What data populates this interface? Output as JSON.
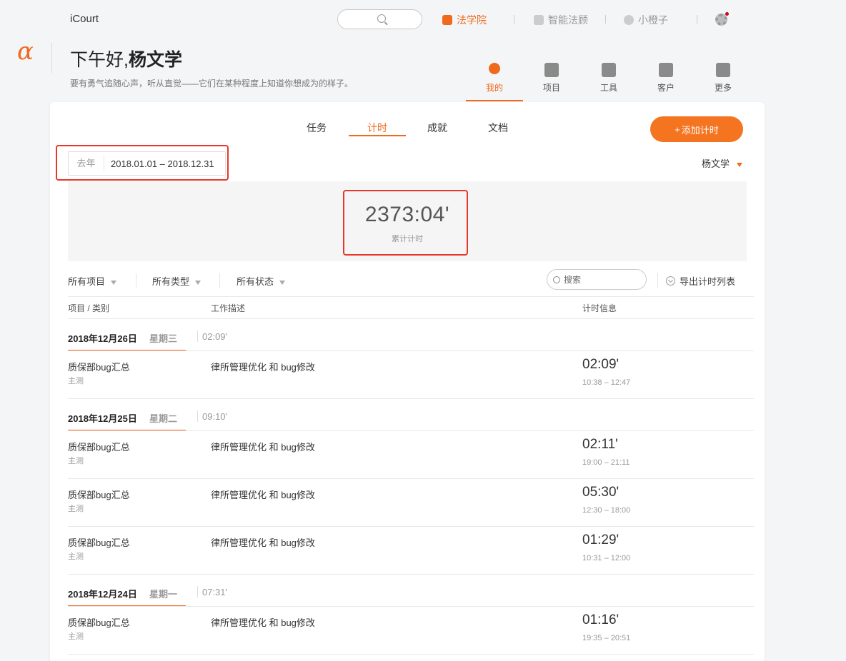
{
  "app": {
    "brand": "iCourt"
  },
  "topnav": {
    "items": [
      {
        "label": "法学院",
        "icon": "play-icon",
        "active": true
      },
      {
        "label": "智能法顾",
        "icon": "document-icon",
        "active": false
      },
      {
        "label": "小橙子",
        "icon": "assistant-icon",
        "active": false
      }
    ],
    "settings_icon": "gear-icon",
    "notification_color": "#d0021b"
  },
  "header": {
    "logo": "α",
    "greeting_prefix": "下午好,",
    "greeting_name": "杨文学",
    "motto": "要有勇气追随心声，听从直觉——它们在某种程度上知道你想成为的样子。"
  },
  "modules": [
    {
      "label": "我的",
      "icon": "user-icon",
      "active": true
    },
    {
      "label": "项目",
      "icon": "briefcase-icon",
      "active": false
    },
    {
      "label": "工具",
      "icon": "tools-icon",
      "active": false
    },
    {
      "label": "客户",
      "icon": "contact-card-icon",
      "active": false
    },
    {
      "label": "更多",
      "icon": "more-apps-icon",
      "active": false
    }
  ],
  "tabs": [
    {
      "label": "任务",
      "active": false
    },
    {
      "label": "计时",
      "active": true
    },
    {
      "label": "成就",
      "active": false
    },
    {
      "label": "文档",
      "active": false
    }
  ],
  "add_button": {
    "icon": "+",
    "label": "添加计时"
  },
  "date_filter": {
    "preset": "去年",
    "range": "2018.01.01 – 2018.12.31"
  },
  "user_select": "杨文学",
  "summary": {
    "total": "2373:04'",
    "label": "累计计时"
  },
  "filters": {
    "project": "所有项目",
    "type": "所有类型",
    "status": "所有状态",
    "search_placeholder": "搜索",
    "export": "导出计时列表"
  },
  "columns": {
    "project": "项目 / 类别",
    "description": "工作描述",
    "timing": "计时信息"
  },
  "days": [
    {
      "date": "2018年12月26日",
      "weekday": "星期三",
      "total": "02:09'",
      "entries": [
        {
          "project": "质保部bug汇总",
          "category": "主测",
          "description": "律所管理优化 和 bug修改",
          "duration": "02:09'",
          "span": "10:38 – 12:47"
        }
      ]
    },
    {
      "date": "2018年12月25日",
      "weekday": "星期二",
      "total": "09:10'",
      "entries": [
        {
          "project": "质保部bug汇总",
          "category": "主测",
          "description": "律所管理优化 和 bug修改",
          "duration": "02:11'",
          "span": "19:00 – 21:11"
        },
        {
          "project": "质保部bug汇总",
          "category": "主测",
          "description": "律所管理优化 和 bug修改",
          "duration": "05:30'",
          "span": "12:30 – 18:00"
        },
        {
          "project": "质保部bug汇总",
          "category": "主测",
          "description": "律所管理优化 和 bug修改",
          "duration": "01:29'",
          "span": "10:31 – 12:00"
        }
      ]
    },
    {
      "date": "2018年12月24日",
      "weekday": "星期一",
      "total": "07:31'",
      "entries": [
        {
          "project": "质保部bug汇总",
          "category": "主测",
          "description": "律所管理优化 和 bug修改",
          "duration": "01:16'",
          "span": "19:35 – 20:51"
        }
      ]
    }
  ],
  "colors": {
    "accent": "#f06a1e",
    "highlight": "#e8372a"
  }
}
